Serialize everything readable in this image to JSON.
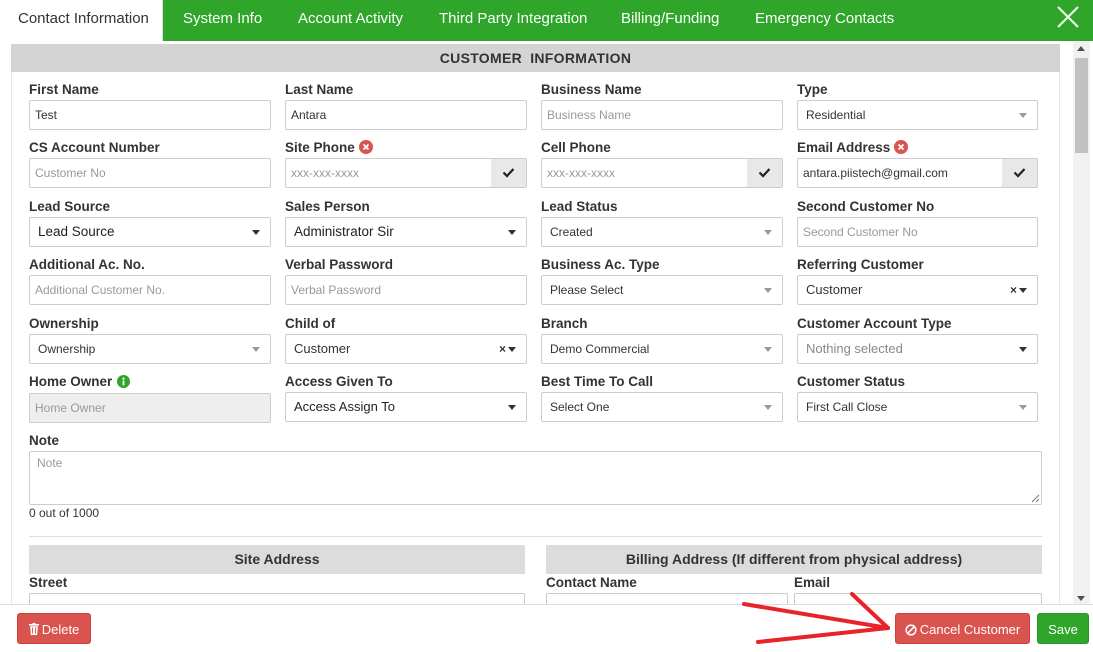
{
  "tabs": [
    {
      "label": "Contact Information",
      "active": true
    },
    {
      "label": "System Info"
    },
    {
      "label": "Account Activity"
    },
    {
      "label": "Third Party Integration"
    },
    {
      "label": "Billing/Funding"
    },
    {
      "label": "Emergency Contacts"
    }
  ],
  "section_title": "CUSTOMER INFORMATION",
  "fields": {
    "first_name": {
      "label": "First Name",
      "value": "Test"
    },
    "last_name": {
      "label": "Last Name",
      "value": "Antara"
    },
    "business_name": {
      "label": "Business Name",
      "placeholder": "Business Name"
    },
    "type": {
      "label": "Type",
      "value": "Residential"
    },
    "cs_account_number": {
      "label": "CS Account Number",
      "placeholder": "Customer No"
    },
    "site_phone": {
      "label": "Site Phone",
      "placeholder": "xxx-xxx-xxxx"
    },
    "cell_phone": {
      "label": "Cell Phone",
      "placeholder": "xxx-xxx-xxxx"
    },
    "email_address": {
      "label": "Email Address",
      "value": "antara.piistech@gmail.com"
    },
    "lead_source": {
      "label": "Lead Source",
      "value": "Lead Source"
    },
    "sales_person": {
      "label": "Sales Person",
      "value": "Administrator Sir"
    },
    "lead_status": {
      "label": "Lead Status",
      "value": "Created"
    },
    "second_customer_no": {
      "label": "Second Customer No",
      "placeholder": "Second Customer No"
    },
    "additional_ac_no": {
      "label": "Additional Ac. No.",
      "placeholder": "Additional Customer No."
    },
    "verbal_password": {
      "label": "Verbal Password",
      "placeholder": "Verbal Password"
    },
    "business_ac_type": {
      "label": "Business Ac. Type",
      "value": "Please Select"
    },
    "referring_customer": {
      "label": "Referring Customer",
      "value": "Customer"
    },
    "ownership": {
      "label": "Ownership",
      "value": "Ownership"
    },
    "child_of": {
      "label": "Child of",
      "value": "Customer"
    },
    "branch": {
      "label": "Branch",
      "value": "Demo Commercial"
    },
    "customer_account_type": {
      "label": "Customer Account Type",
      "value": "Nothing selected"
    },
    "home_owner": {
      "label": "Home Owner",
      "placeholder": "Home Owner"
    },
    "access_given_to": {
      "label": "Access Given To",
      "value": "Access Assign To"
    },
    "best_time_to_call": {
      "label": "Best Time To Call",
      "value": "Select One"
    },
    "customer_status": {
      "label": "Customer Status",
      "value": "First Call Close"
    },
    "note": {
      "label": "Note",
      "placeholder": "Note",
      "counter": "0 out of 1000"
    }
  },
  "site_address": {
    "title": "Site Address",
    "street_label": "Street"
  },
  "billing_address": {
    "title": "Billing Address (If different from physical address)",
    "contact_name_label": "Contact Name",
    "email_label": "Email"
  },
  "footer": {
    "delete_label": "Delete",
    "cancel_label": "Cancel Customer",
    "save_label": "Save"
  },
  "colors": {
    "accent": "#2fa52a",
    "danger": "#d9534f",
    "annotation_arrow": "#e8232a"
  }
}
